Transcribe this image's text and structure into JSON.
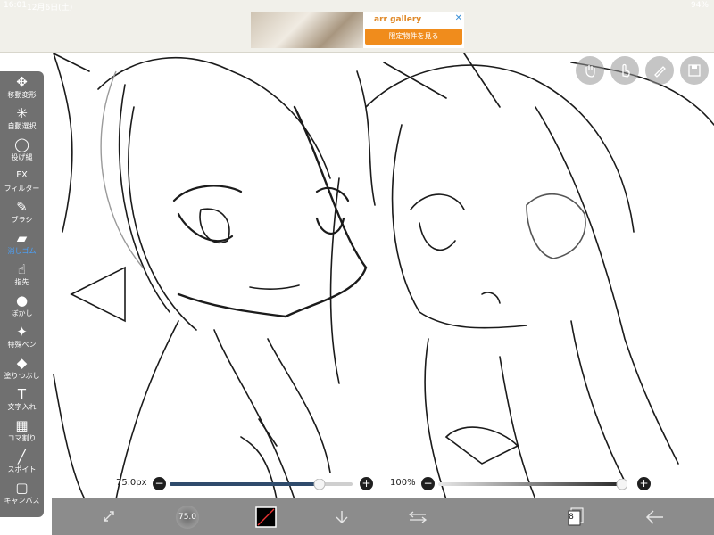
{
  "status_bar": {
    "time": "16:01",
    "date": "12月6日(土)",
    "battery": "94%"
  },
  "ad": {
    "brand": "arr gallery",
    "cta": "限定物件を見る",
    "close": "✕"
  },
  "toolbar": {
    "tools": [
      {
        "label": "移動変形",
        "icon": "✥"
      },
      {
        "label": "自動選択",
        "icon": "✳"
      },
      {
        "label": "投げ縄",
        "icon": "◯"
      },
      {
        "label": "フィルター",
        "icon": "FX"
      },
      {
        "label": "ブラシ",
        "icon": "✎"
      },
      {
        "label": "消しゴム",
        "icon": "▰"
      },
      {
        "label": "指先",
        "icon": "☝"
      },
      {
        "label": "ぼかし",
        "icon": "●"
      },
      {
        "label": "特殊ペン",
        "icon": "✦"
      },
      {
        "label": "塗りつぶし",
        "icon": "◆"
      },
      {
        "label": "文字入れ",
        "icon": "T"
      },
      {
        "label": "コマ割り",
        "icon": "▦"
      },
      {
        "label": "スポイト",
        "icon": "╱"
      },
      {
        "label": "キャンバス",
        "icon": "▢"
      }
    ],
    "active_index": 5
  },
  "brush_size": {
    "value": "75.0px",
    "fill": 0.82
  },
  "opacity": {
    "value": "100%",
    "fill": 1.0
  },
  "bottom_bar": {
    "size_badge": "75.0",
    "layer_count": "8",
    "color": "#000000"
  },
  "colors": {
    "accent": "#4aa3ff",
    "slider_fill": "#2f4b6c"
  }
}
